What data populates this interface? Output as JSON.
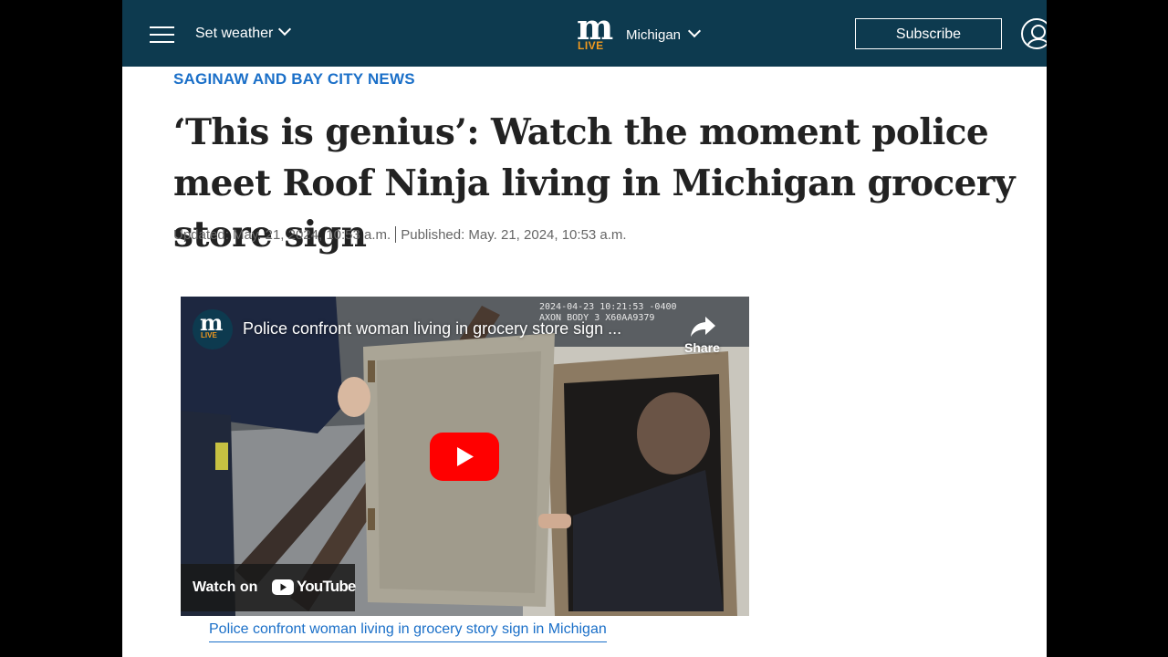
{
  "header": {
    "weather_label": "Set weather",
    "logo_letter": "m",
    "logo_sub": "LIVE",
    "edition_label": "Michigan",
    "subscribe_label": "Subscribe"
  },
  "article": {
    "section": "SAGINAW AND BAY CITY NEWS",
    "headline": "‘This is genius’: Watch the moment police meet Roof Ninja living in Michigan grocery store sign",
    "updated": "Updated: May. 21, 2024, 10:53 a.m.",
    "published": "Published: May. 21, 2024, 10:53 a.m."
  },
  "video": {
    "channel_logo_letter": "m",
    "channel_logo_sub": "LIVE",
    "title": "Police confront woman living in grocery store sign ...",
    "share_label": "Share",
    "bodycam_line1": "2024-04-23 10:21:53 -0400",
    "bodycam_line2": "AXON BODY 3 X60AA9379",
    "watch_on_label": "Watch on",
    "youtube_label": "YouTube",
    "caption": "Police confront woman living in grocery story sign in Michigan"
  },
  "colors": {
    "header_bg": "#0d3a4f",
    "accent_orange": "#f39a1e",
    "link_blue": "#1a6fc8",
    "youtube_red": "#ff0000"
  },
  "icons": [
    "menu-icon",
    "chevron-down-icon",
    "user-icon",
    "share-icon",
    "play-icon",
    "youtube-icon"
  ]
}
